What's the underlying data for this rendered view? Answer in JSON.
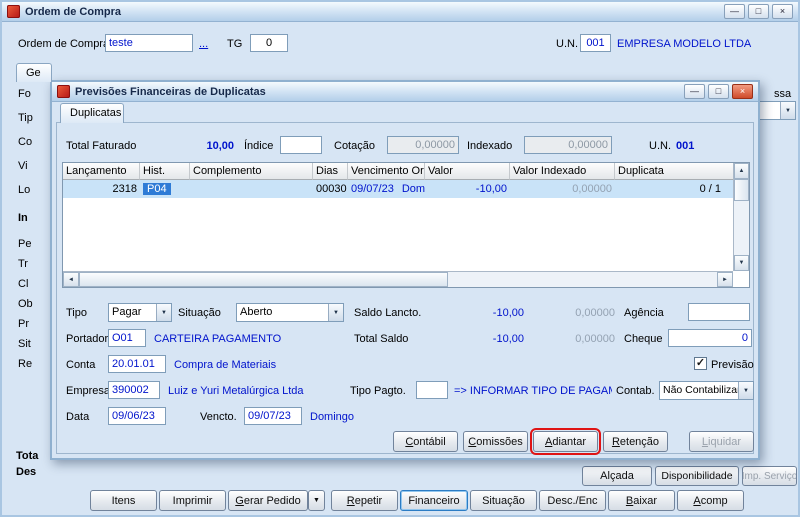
{
  "icons": {
    "minimize": "—",
    "maximize": "□",
    "close": "×",
    "dropdown": "▼",
    "scroll_up": "▲",
    "scroll_down": "▼",
    "scroll_left": "◄",
    "scroll_right": "►",
    "check": "✓"
  },
  "main": {
    "title": "Ordem de Compra",
    "order": {
      "label": "Ordem de Compra",
      "value": "teste",
      "more_link": "...",
      "tg_label": "TG",
      "tg_value": "0",
      "un_label": "U.N.",
      "un_code": "001",
      "un_name": "EMPRESA MODELO LTDA",
      "right_fragment": "ssa"
    },
    "tab_fragment": "Ge",
    "left_fragments": [
      "Fo",
      "Tip",
      "Co",
      "Vi",
      "Lo",
      "In",
      "Pe",
      "Tr",
      "Cl",
      "Ob",
      "Pr",
      "Sit",
      "Re"
    ],
    "bottom_fragments": [
      "Tota",
      "Des"
    ],
    "upper_buttons": [
      {
        "label": "Alçada",
        "disabled": false
      },
      {
        "label": "Disponibilidade",
        "disabled": false
      },
      {
        "label": "Imp. Serviço",
        "disabled": true
      }
    ],
    "lower_buttons": [
      {
        "label": "Itens"
      },
      {
        "label": "Imprimir"
      },
      {
        "label": "Gerar Pedido"
      },
      {
        "label": "Repetir"
      },
      {
        "label": "Financeiro"
      },
      {
        "label": "Situação"
      },
      {
        "label": "Desc./Enc"
      },
      {
        "label": "Baixar"
      },
      {
        "label": "Acomp"
      }
    ]
  },
  "dialog": {
    "title": "Previsões Financeiras de Duplicatas",
    "tab": "Duplicatas",
    "summary": {
      "total_faturado_label": "Total Faturado",
      "total_faturado_value": "10,00",
      "indice_label": "Índice",
      "indice_value": "",
      "cotacao_label": "Cotação",
      "cotacao_value": "0,00000",
      "indexado_label": "Indexado",
      "indexado_value": "0,00000",
      "un_label": "U.N.",
      "un_value": "001"
    },
    "table": {
      "headers": [
        "Lançamento",
        "Hist.",
        "Complemento",
        "Dias",
        "Vencimento Orig.",
        "Valor",
        "Valor Indexado",
        "Duplicata"
      ],
      "row": {
        "lancamento": "2318",
        "hist": "P04",
        "complemento": "",
        "dias": "00030",
        "vencimento": "09/07/23",
        "vencimento_dia": "Dom",
        "valor": "-10,00",
        "valor_indexado": "0,00000",
        "duplicata": "0 / 1"
      }
    },
    "form": {
      "tipo_label": "Tipo",
      "tipo_value": "Pagar",
      "situacao_label": "Situação",
      "situacao_value": "Aberto",
      "saldo_lancto_label": "Saldo Lancto.",
      "saldo_lancto_value": "-10,00",
      "saldo_lancto_indexado": "0,00000",
      "agencia_label": "Agência",
      "agencia_value": "",
      "portador_label": "Portador",
      "portador_value": "O01",
      "portador_desc": "CARTEIRA PAGAMENTO",
      "total_saldo_label": "Total Saldo",
      "total_saldo_value": "-10,00",
      "total_saldo_indexado": "0,00000",
      "cheque_label": "Cheque",
      "cheque_value": "0",
      "conta_label": "Conta",
      "conta_value": "20.01.01",
      "conta_desc": "Compra de Materiais",
      "previsao_label": "Previsão",
      "previsao_checked": true,
      "empresa_label": "Empresa",
      "empresa_value": "390002",
      "empresa_desc": "Luiz e Yuri Metalúrgica Ltda",
      "tipo_pagto_label": "Tipo Pagto.",
      "tipo_pagto_value": "",
      "tipo_pagto_hint": "=> INFORMAR TIPO DE PAGAM",
      "contab_label": "Contab.",
      "contab_value": "Não Contabilizar",
      "data_label": "Data",
      "data_value": "09/06/23",
      "vencto_label": "Vencto.",
      "vencto_value": "09/07/23",
      "vencto_dia": "Domingo"
    },
    "buttons": [
      {
        "label": "Contábil",
        "disabled": false
      },
      {
        "label": "Comissões",
        "disabled": false
      },
      {
        "label": "Adiantar",
        "disabled": false,
        "annotated": true
      },
      {
        "label": "Retenção",
        "disabled": false
      },
      {
        "label": "Liquidar",
        "disabled": true
      }
    ]
  }
}
